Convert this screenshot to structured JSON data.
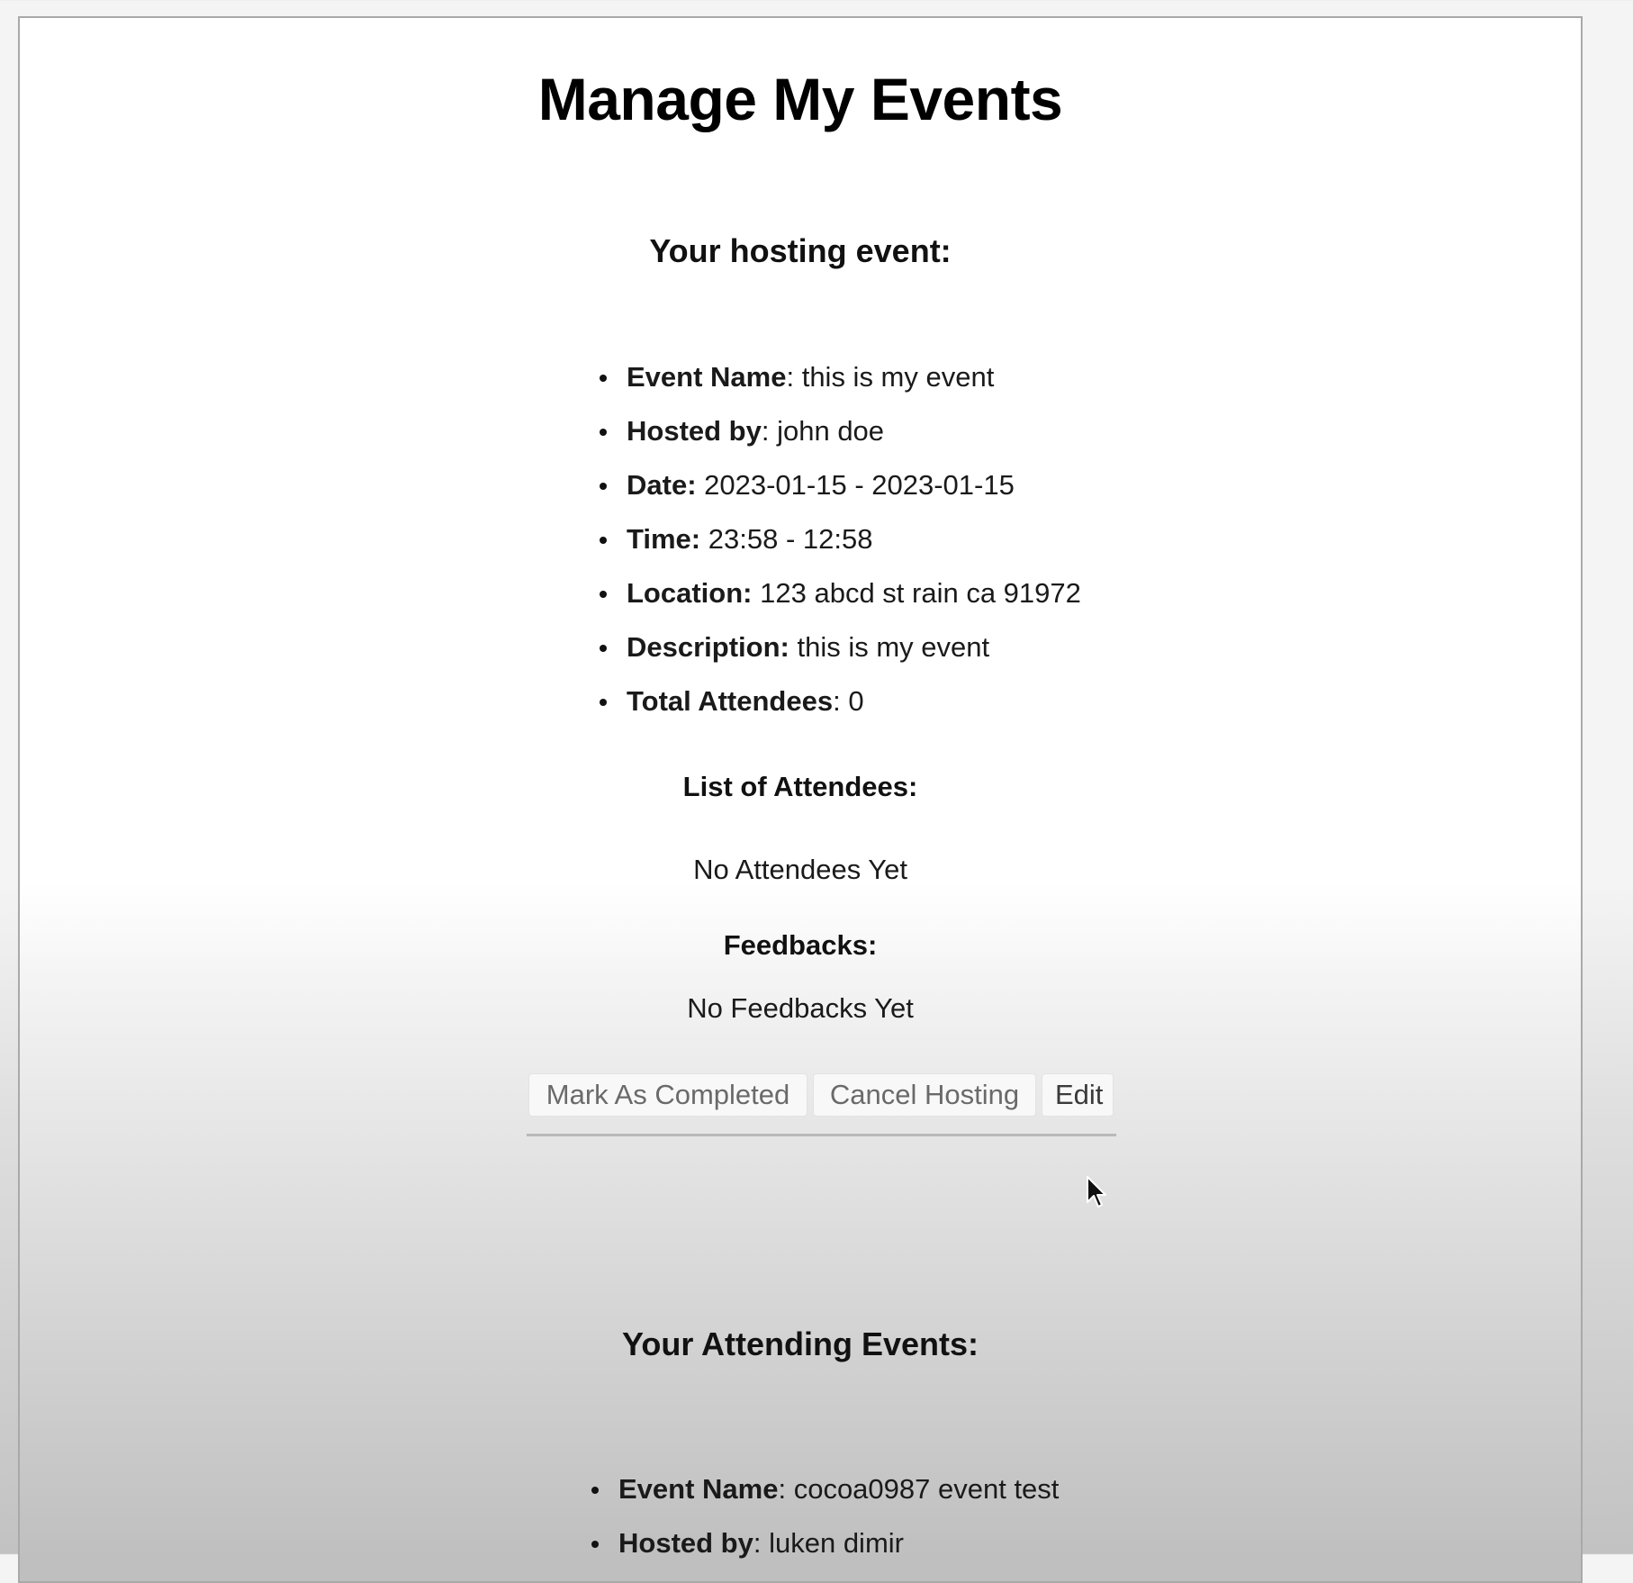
{
  "page": {
    "title": "Manage My Events"
  },
  "hosting": {
    "heading": "Your hosting event:",
    "details": [
      {
        "label": "Event Name",
        "sep": ": ",
        "value": "this is my event"
      },
      {
        "label": "Hosted by",
        "sep": ": ",
        "value": "john doe"
      },
      {
        "label": "Date:",
        "sep": " ",
        "value": "2023-01-15 - 2023-01-15"
      },
      {
        "label": "Time:",
        "sep": " ",
        "value": "23:58 - 12:58"
      },
      {
        "label": "Location:",
        "sep": " ",
        "value": "123 abcd st rain ca 91972"
      },
      {
        "label": "Description:",
        "sep": " ",
        "value": "this is my event"
      },
      {
        "label": "Total Attendees",
        "sep": ": ",
        "value": "0"
      }
    ],
    "attendees_heading": "List of Attendees:",
    "attendees_empty": "No Attendees Yet",
    "feedbacks_heading": "Feedbacks:",
    "feedbacks_empty": "No Feedbacks Yet",
    "buttons": {
      "mark_completed": "Mark As Completed",
      "cancel_hosting": "Cancel Hosting",
      "edit": "Edit"
    }
  },
  "attending": {
    "heading": "Your Attending Events:",
    "details": [
      {
        "label": "Event Name",
        "sep": ": ",
        "value": "cocoa0987 event test"
      },
      {
        "label": "Hosted by",
        "sep": ": ",
        "value": "luken dimir"
      }
    ]
  },
  "icons": {
    "cursor": "mouse-pointer-icon"
  }
}
